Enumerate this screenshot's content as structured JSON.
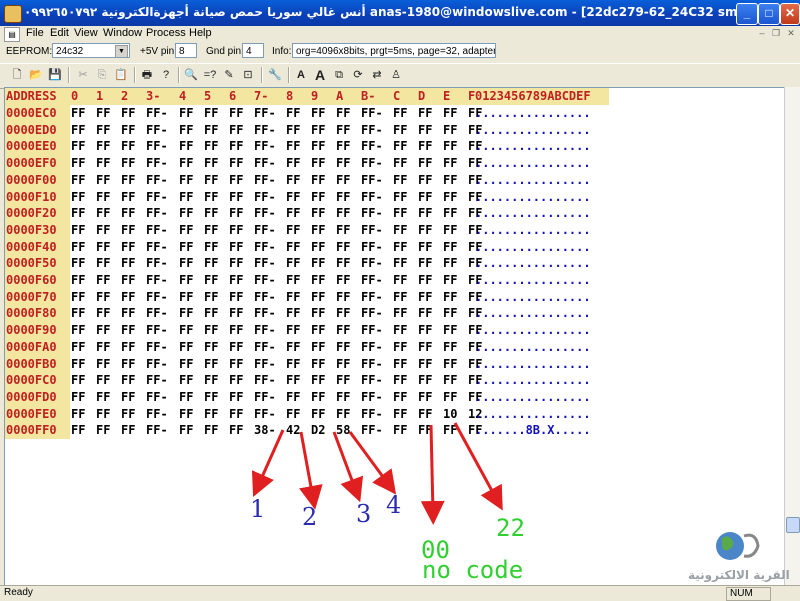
{
  "window": {
    "title": "أنس غالي سوريا حمص صيانة أجهزةالكترونية ٠٩٩٢٦٥٠٧٩٢  anas-1980@windowslive.com - [22dc279-62_24C32 smd code8425]"
  },
  "menu": [
    "File",
    "Edit",
    "View",
    "Window",
    "Process",
    "Help"
  ],
  "infobar": {
    "eeprom_label": "EEPROM:",
    "eeprom_value": "24c32",
    "pin5v_label": "+5V pin:",
    "pin5v_value": "8",
    "gnd_label": "Gnd pin:",
    "gnd_value": "4",
    "info_label": "Info:",
    "info_value": "org=4096x8bits, prgt=5ms, page=32, adapter=1"
  },
  "toolbar_icons": [
    "new-icon",
    "open-icon",
    "save-icon",
    "cut-icon",
    "copy-icon",
    "paste-icon",
    "print-icon",
    "help-icon",
    "find-icon",
    "compare-icon",
    "edit-icon",
    "binary-icon",
    "tools-icon",
    "font-a-icon",
    "font-a-large-icon",
    "copy-page-icon",
    "reload-icon",
    "swap-icon",
    "user-icon"
  ],
  "hex": {
    "header": {
      "address": "ADDRESS",
      "columns": [
        "0",
        "1",
        "2",
        "3-",
        "4",
        "5",
        "6",
        "7-",
        "8",
        "9",
        "A",
        "B-",
        "C",
        "D",
        "E",
        "F"
      ],
      "ascii": "0123456789ABCDEF"
    },
    "rows": [
      {
        "addr": "0000EC0",
        "bytes": [
          "FF",
          "FF",
          "FF",
          "FF-",
          "FF",
          "FF",
          "FF",
          "FF-",
          "FF",
          "FF",
          "FF",
          "FF-",
          "FF",
          "FF",
          "FF",
          "FF"
        ],
        "ascii": "................"
      },
      {
        "addr": "0000ED0",
        "bytes": [
          "FF",
          "FF",
          "FF",
          "FF-",
          "FF",
          "FF",
          "FF",
          "FF-",
          "FF",
          "FF",
          "FF",
          "FF-",
          "FF",
          "FF",
          "FF",
          "FF"
        ],
        "ascii": "................"
      },
      {
        "addr": "0000EE0",
        "bytes": [
          "FF",
          "FF",
          "FF",
          "FF-",
          "FF",
          "FF",
          "FF",
          "FF-",
          "FF",
          "FF",
          "FF",
          "FF-",
          "FF",
          "FF",
          "FF",
          "FF"
        ],
        "ascii": "................"
      },
      {
        "addr": "0000EF0",
        "bytes": [
          "FF",
          "FF",
          "FF",
          "FF-",
          "FF",
          "FF",
          "FF",
          "FF-",
          "FF",
          "FF",
          "FF",
          "FF-",
          "FF",
          "FF",
          "FF",
          "FF"
        ],
        "ascii": "................"
      },
      {
        "addr": "0000F00",
        "bytes": [
          "FF",
          "FF",
          "FF",
          "FF-",
          "FF",
          "FF",
          "FF",
          "FF-",
          "FF",
          "FF",
          "FF",
          "FF-",
          "FF",
          "FF",
          "FF",
          "FF"
        ],
        "ascii": "................"
      },
      {
        "addr": "0000F10",
        "bytes": [
          "FF",
          "FF",
          "FF",
          "FF-",
          "FF",
          "FF",
          "FF",
          "FF-",
          "FF",
          "FF",
          "FF",
          "FF-",
          "FF",
          "FF",
          "FF",
          "FF"
        ],
        "ascii": "................"
      },
      {
        "addr": "0000F20",
        "bytes": [
          "FF",
          "FF",
          "FF",
          "FF-",
          "FF",
          "FF",
          "FF",
          "FF-",
          "FF",
          "FF",
          "FF",
          "FF-",
          "FF",
          "FF",
          "FF",
          "FF"
        ],
        "ascii": "................"
      },
      {
        "addr": "0000F30",
        "bytes": [
          "FF",
          "FF",
          "FF",
          "FF-",
          "FF",
          "FF",
          "FF",
          "FF-",
          "FF",
          "FF",
          "FF",
          "FF-",
          "FF",
          "FF",
          "FF",
          "FF"
        ],
        "ascii": "................"
      },
      {
        "addr": "0000F40",
        "bytes": [
          "FF",
          "FF",
          "FF",
          "FF-",
          "FF",
          "FF",
          "FF",
          "FF-",
          "FF",
          "FF",
          "FF",
          "FF-",
          "FF",
          "FF",
          "FF",
          "FF"
        ],
        "ascii": "................"
      },
      {
        "addr": "0000F50",
        "bytes": [
          "FF",
          "FF",
          "FF",
          "FF-",
          "FF",
          "FF",
          "FF",
          "FF-",
          "FF",
          "FF",
          "FF",
          "FF-",
          "FF",
          "FF",
          "FF",
          "FF"
        ],
        "ascii": "................"
      },
      {
        "addr": "0000F60",
        "bytes": [
          "FF",
          "FF",
          "FF",
          "FF-",
          "FF",
          "FF",
          "FF",
          "FF-",
          "FF",
          "FF",
          "FF",
          "FF-",
          "FF",
          "FF",
          "FF",
          "FF"
        ],
        "ascii": "................"
      },
      {
        "addr": "0000F70",
        "bytes": [
          "FF",
          "FF",
          "FF",
          "FF-",
          "FF",
          "FF",
          "FF",
          "FF-",
          "FF",
          "FF",
          "FF",
          "FF-",
          "FF",
          "FF",
          "FF",
          "FF"
        ],
        "ascii": "................"
      },
      {
        "addr": "0000F80",
        "bytes": [
          "FF",
          "FF",
          "FF",
          "FF-",
          "FF",
          "FF",
          "FF",
          "FF-",
          "FF",
          "FF",
          "FF",
          "FF-",
          "FF",
          "FF",
          "FF",
          "FF"
        ],
        "ascii": "................"
      },
      {
        "addr": "0000F90",
        "bytes": [
          "FF",
          "FF",
          "FF",
          "FF-",
          "FF",
          "FF",
          "FF",
          "FF-",
          "FF",
          "FF",
          "FF",
          "FF-",
          "FF",
          "FF",
          "FF",
          "FF"
        ],
        "ascii": "................"
      },
      {
        "addr": "0000FA0",
        "bytes": [
          "FF",
          "FF",
          "FF",
          "FF-",
          "FF",
          "FF",
          "FF",
          "FF-",
          "FF",
          "FF",
          "FF",
          "FF-",
          "FF",
          "FF",
          "FF",
          "FF"
        ],
        "ascii": "................"
      },
      {
        "addr": "0000FB0",
        "bytes": [
          "FF",
          "FF",
          "FF",
          "FF-",
          "FF",
          "FF",
          "FF",
          "FF-",
          "FF",
          "FF",
          "FF",
          "FF-",
          "FF",
          "FF",
          "FF",
          "FF"
        ],
        "ascii": "................"
      },
      {
        "addr": "0000FC0",
        "bytes": [
          "FF",
          "FF",
          "FF",
          "FF-",
          "FF",
          "FF",
          "FF",
          "FF-",
          "FF",
          "FF",
          "FF",
          "FF-",
          "FF",
          "FF",
          "FF",
          "FF"
        ],
        "ascii": "................"
      },
      {
        "addr": "0000FD0",
        "bytes": [
          "FF",
          "FF",
          "FF",
          "FF-",
          "FF",
          "FF",
          "FF",
          "FF-",
          "FF",
          "FF",
          "FF",
          "FF-",
          "FF",
          "FF",
          "FF",
          "FF"
        ],
        "ascii": "................"
      },
      {
        "addr": "0000FE0",
        "bytes": [
          "FF",
          "FF",
          "FF",
          "FF-",
          "FF",
          "FF",
          "FF",
          "FF-",
          "FF",
          "FF",
          "FF",
          "FF-",
          "FF",
          "FF",
          "10",
          "12"
        ],
        "ascii": "................"
      },
      {
        "addr": "0000FF0",
        "bytes": [
          "FF",
          "FF",
          "FF",
          "FF-",
          "FF",
          "FF",
          "FF",
          "38-",
          "42",
          "D2",
          "58",
          "FF-",
          "FF",
          "FF",
          "FF",
          "FF"
        ],
        "ascii": ".......8B.X....."
      }
    ]
  },
  "annotations": {
    "labels": [
      "1",
      "2",
      "3",
      "4"
    ],
    "green_values": [
      "00",
      "22"
    ],
    "no_code": "no code",
    "arrow_color": "#e02020"
  },
  "logo": {
    "text": "القرية الالكترونية"
  },
  "status": {
    "text": "Ready",
    "num": "NUM"
  }
}
